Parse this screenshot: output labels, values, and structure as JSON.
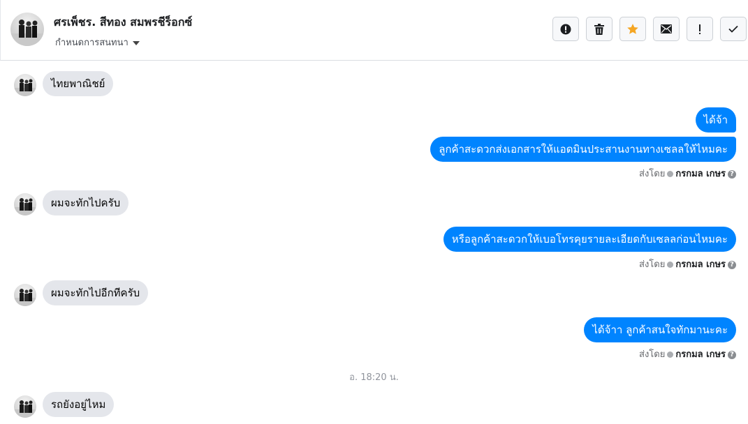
{
  "header": {
    "name": "ศรเพ็ชร. สีทอง สมพรชีร็อกซ์",
    "subtitle": "กำหนดการสนทนา"
  },
  "toolbar": [
    {
      "name": "report-button",
      "icon": "exclamation-circle-icon"
    },
    {
      "name": "delete-button",
      "icon": "trash-icon"
    },
    {
      "name": "star-button",
      "icon": "star-icon",
      "color": "#f5a623"
    },
    {
      "name": "mark-unread-button",
      "icon": "envelope-icon"
    },
    {
      "name": "important-button",
      "icon": "exclamation-icon"
    },
    {
      "name": "done-button",
      "icon": "check-icon"
    }
  ],
  "messages": {
    "m1": "ไทยพาณิชย์",
    "m2": "ได้จ้า",
    "m3": "ลูกค้าสะดวกส่งเอกสารให้แอดมินประสานงานทางเซลลให้ไหมคะ",
    "m4": "ผมจะทักไปครับ",
    "m5": "หรือลูกค้าสะดวกให้เบอโทรคุยรายละเอียดกับเซลลก่อนไหมคะ",
    "m6": "ผมจะทักไปอีกทีครับ",
    "m7": "ได้จ้าา ลูกค้าสนใจทักมานะคะ",
    "m8": "รถยังอยู่ไหม"
  },
  "sent_by": {
    "label": "ส่งโดย",
    "agent": "กรกมล เกษร"
  },
  "timestamp": "อ. 18:20 น.",
  "colors": {
    "outgoing_bubble": "#0084ff",
    "incoming_bubble": "#e4e6eb"
  }
}
